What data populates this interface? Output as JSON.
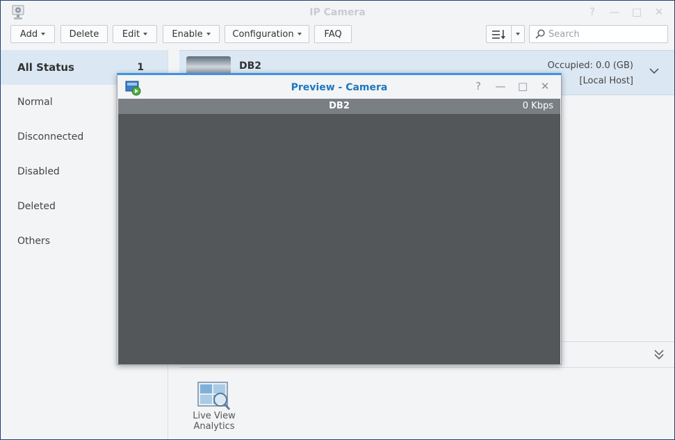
{
  "window": {
    "title": "IP Camera"
  },
  "titlebar": {
    "help": "?",
    "minimize": "—",
    "maximize": "□",
    "close": "✕"
  },
  "toolbar": {
    "add": "Add",
    "delete": "Delete",
    "edit": "Edit",
    "enable": "Enable",
    "configuration": "Configuration",
    "faq": "FAQ",
    "search_placeholder": "Search"
  },
  "sidebar": {
    "items": [
      {
        "label": "All Status",
        "count": "1"
      },
      {
        "label": "Normal"
      },
      {
        "label": "Disconnected"
      },
      {
        "label": "Disabled"
      },
      {
        "label": "Deleted"
      },
      {
        "label": "Others"
      }
    ]
  },
  "camera": {
    "name": "DB2",
    "occupied": "Occupied: 0.0 (GB)",
    "host": "[Local Host]"
  },
  "apps": {
    "live_view_line1": "Live View",
    "live_view_line2": "Analytics"
  },
  "modal": {
    "title": "Preview - Camera",
    "help": "?",
    "minimize": "—",
    "maximize": "□",
    "close": "✕",
    "camera_name": "DB2",
    "bitrate": "0 Kbps"
  },
  "colors": {
    "accent": "#1f77bd",
    "selected_bg": "#dbe8f3",
    "modal_border": "#3e92e0",
    "video_bg": "#53575a"
  }
}
